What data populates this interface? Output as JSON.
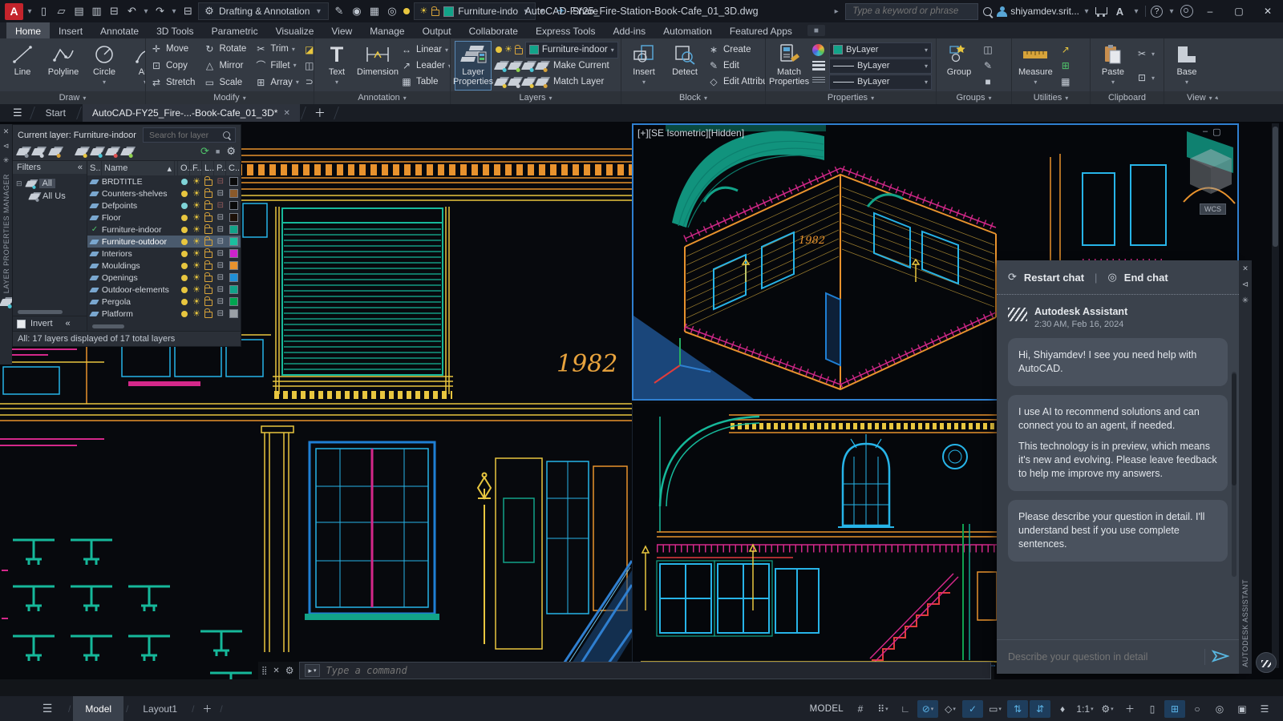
{
  "glyphs": {
    "caret": "▾",
    "caret_up": "▴",
    "hamburger": "☰",
    "close": "✕",
    "plus": "＋",
    "minus": "‒",
    "maximize": "▢",
    "undo": "↶",
    "redo": "↷",
    "new_file": "▯",
    "open": "▱",
    "save": "▤",
    "save_as": "▥",
    "print": "⊟",
    "gear": "⚙",
    "share": "✈",
    "pen": "✎",
    "render": "◉",
    "calc": "▦",
    "review": "◎",
    "chev_right": "▸",
    "prompt": "▸",
    "grip": "⣿",
    "wrench": "⚙",
    "refresh": "⟳",
    "check": "✓",
    "sun": "☀",
    "printer": "⊟",
    "tree_collapse": "⊟",
    "chevrons_left": "«",
    "rect": "▭",
    "ellipse": "○",
    "hatch": "▨",
    "move": "✛",
    "rotate": "↻",
    "trim": "✂",
    "copy": "⊡",
    "mirror": "△",
    "fillet": "⌒",
    "stretch": "⇄",
    "scale": "▭",
    "array": "⊞",
    "erase": "◪",
    "explode": "◫",
    "join": "⊃",
    "linear": "↔",
    "leader": "↗",
    "table": "▦",
    "create": "∗",
    "edit": "✎",
    "edit_attr": "◇",
    "arrow_left": "⊲",
    "diamond": "♦",
    "question": "?",
    "circle": "◎",
    "square": "■",
    "star": "✳"
  },
  "titlebar": {
    "logo": "A",
    "workspace": "Drafting & Annotation",
    "quick_layer": "Furniture-indo",
    "share_label": "Share",
    "doc_title": "AutoCAD-FY25_Fire-Station-Book-Cafe_01_3D.dwg",
    "search_placeholder": "Type a keyword or phrase",
    "user": "shiyamdev.srit..."
  },
  "ribbon": {
    "tabs": [
      "Home",
      "Insert",
      "Annotate",
      "3D Tools",
      "Parametric",
      "Visualize",
      "View",
      "Manage",
      "Output",
      "Collaborate",
      "Express Tools",
      "Add-ins",
      "Automation",
      "Featured Apps"
    ],
    "active_tab": "Home",
    "draw": {
      "title": "Draw",
      "items": [
        "Line",
        "Polyline",
        "Circle",
        "Arc"
      ]
    },
    "modify": {
      "title": "Modify",
      "items": [
        "Move",
        "Rotate",
        "Trim",
        "Copy",
        "Mirror",
        "Fillet",
        "Stretch",
        "Scale",
        "Array"
      ],
      "glyph_keys": [
        "move",
        "rotate",
        "trim",
        "copy",
        "mirror",
        "fillet",
        "stretch",
        "scale",
        "array"
      ],
      "caret_indices": [
        2,
        5,
        8
      ]
    },
    "annotation": {
      "title": "Annotation",
      "big": [
        "Text",
        "Dimension"
      ],
      "small": [
        "Linear",
        "Leader",
        "Table"
      ],
      "small_glyphs": [
        "linear",
        "leader",
        "table"
      ],
      "small_carets": [
        true,
        true,
        false
      ]
    },
    "layers": {
      "title": "Layers",
      "big_line1": "Layer",
      "big_line2": "Properties",
      "dropdown": "Furniture-indoor",
      "buttons": [
        "Make Current",
        "Match Layer"
      ]
    },
    "block": {
      "title": "Block",
      "big": [
        "Insert",
        "Detect"
      ],
      "small": [
        "Create",
        "Edit",
        "Edit Attributes"
      ],
      "small_glyphs": [
        "create",
        "edit",
        "edit_attr"
      ],
      "small_carets": [
        false,
        false,
        true
      ]
    },
    "properties": {
      "title": "Properties",
      "big_line1": "Match",
      "big_line2": "Properties",
      "values": [
        "ByLayer",
        "ByLayer",
        "ByLayer"
      ]
    },
    "groups": {
      "title": "Groups",
      "big": "Group"
    },
    "utilities": {
      "title": "Utilities",
      "big": "Measure"
    },
    "clipboard": {
      "title": "Clipboard",
      "big": "Paste"
    },
    "view": {
      "title": "View",
      "big": "Base"
    }
  },
  "doc_tabs": {
    "start": "Start",
    "active": "AutoCAD-FY25_Fire-...-Book-Cafe_01_3D*"
  },
  "layer_palette": {
    "current_layer": "Current layer: Furniture-indoor",
    "search_placeholder": "Search for layer",
    "filters_label": "Filters",
    "tree_root": "All",
    "tree_child": "All Us",
    "columns": [
      "S..",
      "Name",
      "O..",
      "F..",
      "L..",
      "P..",
      "C.."
    ],
    "layers": [
      {
        "name": "BRDTITLE",
        "color": "#0a0a0a",
        "on": false,
        "plot": false
      },
      {
        "name": "Counters-shelves",
        "color": "#8a5a2b",
        "on": true,
        "plot": true
      },
      {
        "name": "Defpoints",
        "color": "#0a0a0a",
        "on": false,
        "plot": false
      },
      {
        "name": "Floor",
        "color": "#1c1008",
        "on": true,
        "plot": true
      },
      {
        "name": "Furniture-indoor",
        "color": "#12a389",
        "on": true,
        "plot": true,
        "current": true
      },
      {
        "name": "Furniture-outdoor",
        "color": "#1bbf9e",
        "on": true,
        "plot": true,
        "selected": true
      },
      {
        "name": "Interiors",
        "color": "#cc22cc",
        "on": true,
        "plot": true
      },
      {
        "name": "Mouldings",
        "color": "#e8922d",
        "on": true,
        "plot": true
      },
      {
        "name": "Openings",
        "color": "#1f8fd6",
        "on": true,
        "plot": true
      },
      {
        "name": "Outdoor-elements",
        "color": "#12a389",
        "on": true,
        "plot": true
      },
      {
        "name": "Pergola",
        "color": "#00a550",
        "on": true,
        "plot": true
      },
      {
        "name": "Platform",
        "color": "#9aa0a6",
        "on": true,
        "plot": true
      }
    ],
    "invert_label": "Invert",
    "status": "All: 17 layers displayed of 17 total layers",
    "vertical_title": "LAYER PROPERTIES MANAGER"
  },
  "canvas": {
    "viewport_label": "[+][SE Isometric][Hidden]",
    "wcs": "WCS",
    "year_text": "1982"
  },
  "assistant": {
    "restart_label": "Restart chat",
    "end_label": "End chat",
    "name": "Autodesk Assistant",
    "timestamp": "2:30 AM, Feb 16, 2024",
    "messages": [
      [
        "Hi, Shiyamdev! I see you need help with AutoCAD."
      ],
      [
        "I use AI to recommend solutions and can connect you to an agent, if needed.",
        "This technology is in preview, which means it's new and evolving. Please leave feedback to help me improve my answers."
      ],
      [
        "Please describe your question in detail. I'll understand best if you use complete sentences."
      ]
    ],
    "input_placeholder": "Describe your question in detail",
    "vertical_title": "AUTODESK ASSISTANT"
  },
  "command": {
    "placeholder": "Type a command"
  },
  "statusbar": {
    "model_tab": "Model",
    "layout_tab": "Layout1",
    "model_label": "MODEL",
    "icons": [
      {
        "name": "grid-display",
        "glyph": "#"
      },
      {
        "name": "snap-mode",
        "glyph": "⠿",
        "caret": true
      },
      {
        "name": "ortho-mode",
        "glyph": "∟"
      },
      {
        "name": "polar-tracking",
        "glyph": "⊘",
        "active": true,
        "caret": true
      },
      {
        "name": "isometric-drafting",
        "glyph": "◇",
        "caret": true
      },
      {
        "name": "object-snap",
        "glyph": "✓",
        "active": true
      },
      {
        "name": "selection-cycling",
        "glyph": "▭",
        "caret": true
      },
      {
        "name": "lineweight-display",
        "glyph": "⇅",
        "active": true
      },
      {
        "name": "transparency",
        "glyph": "⇵",
        "active": true
      },
      {
        "name": "selection-filter",
        "glyph": "♦"
      },
      {
        "name": "annotation-scale",
        "glyph": "1:1",
        "caret": true
      },
      {
        "name": "workspace-switching",
        "glyph": "⚙",
        "caret": true
      },
      {
        "name": "annotation-monitor",
        "glyph": "＋"
      },
      {
        "name": "units",
        "glyph": "▯"
      },
      {
        "name": "quick-properties",
        "glyph": "⊞",
        "active": true
      },
      {
        "name": "lock-ui",
        "glyph": "○"
      },
      {
        "name": "graphics-performance",
        "glyph": "◎"
      },
      {
        "name": "clean-screen",
        "glyph": "▣"
      },
      {
        "name": "customization",
        "glyph": "☰"
      }
    ]
  }
}
